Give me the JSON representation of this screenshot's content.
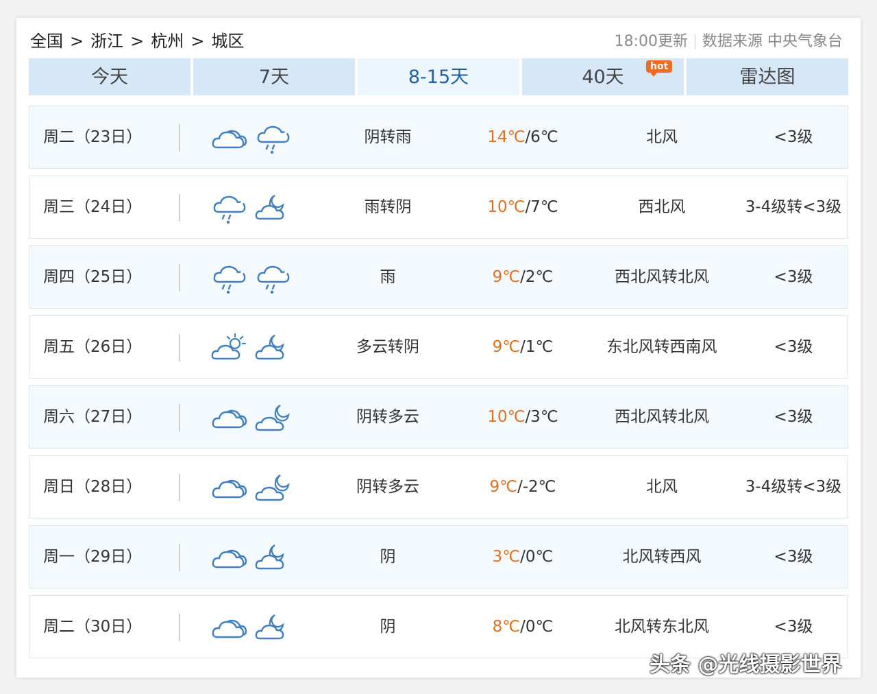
{
  "breadcrumb": {
    "items": [
      "全国",
      "浙江",
      "杭州",
      "城区"
    ],
    "separator": ">"
  },
  "meta": {
    "update": "18:00更新",
    "source": "数据来源 中央气象台"
  },
  "tabs": [
    {
      "label": "今天"
    },
    {
      "label": "7天"
    },
    {
      "label": "8-15天"
    },
    {
      "label": "40天",
      "badge": "hot"
    },
    {
      "label": "雷达图"
    }
  ],
  "active_tab": "8-15天",
  "colors": {
    "accent": "#1f5fa8",
    "high_temp": "#e07020",
    "tab_bg": "#d6e8f8",
    "icon_stroke": "#3f7fbf"
  },
  "forecast": [
    {
      "date": "周二（23日）",
      "icons": [
        "cloudy-icon",
        "rain-icon"
      ],
      "desc": "阴转雨",
      "high": "14℃",
      "low": "/6℃",
      "wind": "北风",
      "level": "<3级"
    },
    {
      "date": "周三（24日）",
      "icons": [
        "rain-icon",
        "cloudy-night-icon"
      ],
      "desc": "雨转阴",
      "high": "10℃",
      "low": "/7℃",
      "wind": "西北风",
      "level": "3-4级转<3级"
    },
    {
      "date": "周四（25日）",
      "icons": [
        "rain-icon",
        "rain-icon"
      ],
      "desc": "雨",
      "high": "9℃",
      "low": "/2℃",
      "wind": "西北风转北风",
      "level": "<3级"
    },
    {
      "date": "周五（26日）",
      "icons": [
        "partly-cloudy-day-icon",
        "cloudy-night-icon"
      ],
      "desc": "多云转阴",
      "high": "9℃",
      "low": "/1℃",
      "wind": "东北风转西南风",
      "level": "<3级"
    },
    {
      "date": "周六（27日）",
      "icons": [
        "cloudy-icon",
        "partly-cloudy-night-icon"
      ],
      "desc": "阴转多云",
      "high": "10℃",
      "low": "/3℃",
      "wind": "西北风转北风",
      "level": "<3级"
    },
    {
      "date": "周日（28日）",
      "icons": [
        "cloudy-icon",
        "partly-cloudy-night-icon"
      ],
      "desc": "阴转多云",
      "high": "9℃",
      "low": "/-2℃",
      "wind": "北风",
      "level": "3-4级转<3级"
    },
    {
      "date": "周一（29日）",
      "icons": [
        "cloudy-icon",
        "cloudy-night-icon"
      ],
      "desc": "阴",
      "high": "3℃",
      "low": "/0℃",
      "wind": "北风转西风",
      "level": "<3级"
    },
    {
      "date": "周二（30日）",
      "icons": [
        "cloudy-icon",
        "cloudy-night-icon"
      ],
      "desc": "阴",
      "high": "8℃",
      "low": "/0℃",
      "wind": "北风转东北风",
      "level": "<3级"
    }
  ],
  "watermark": "头条 @光线摄影世界"
}
